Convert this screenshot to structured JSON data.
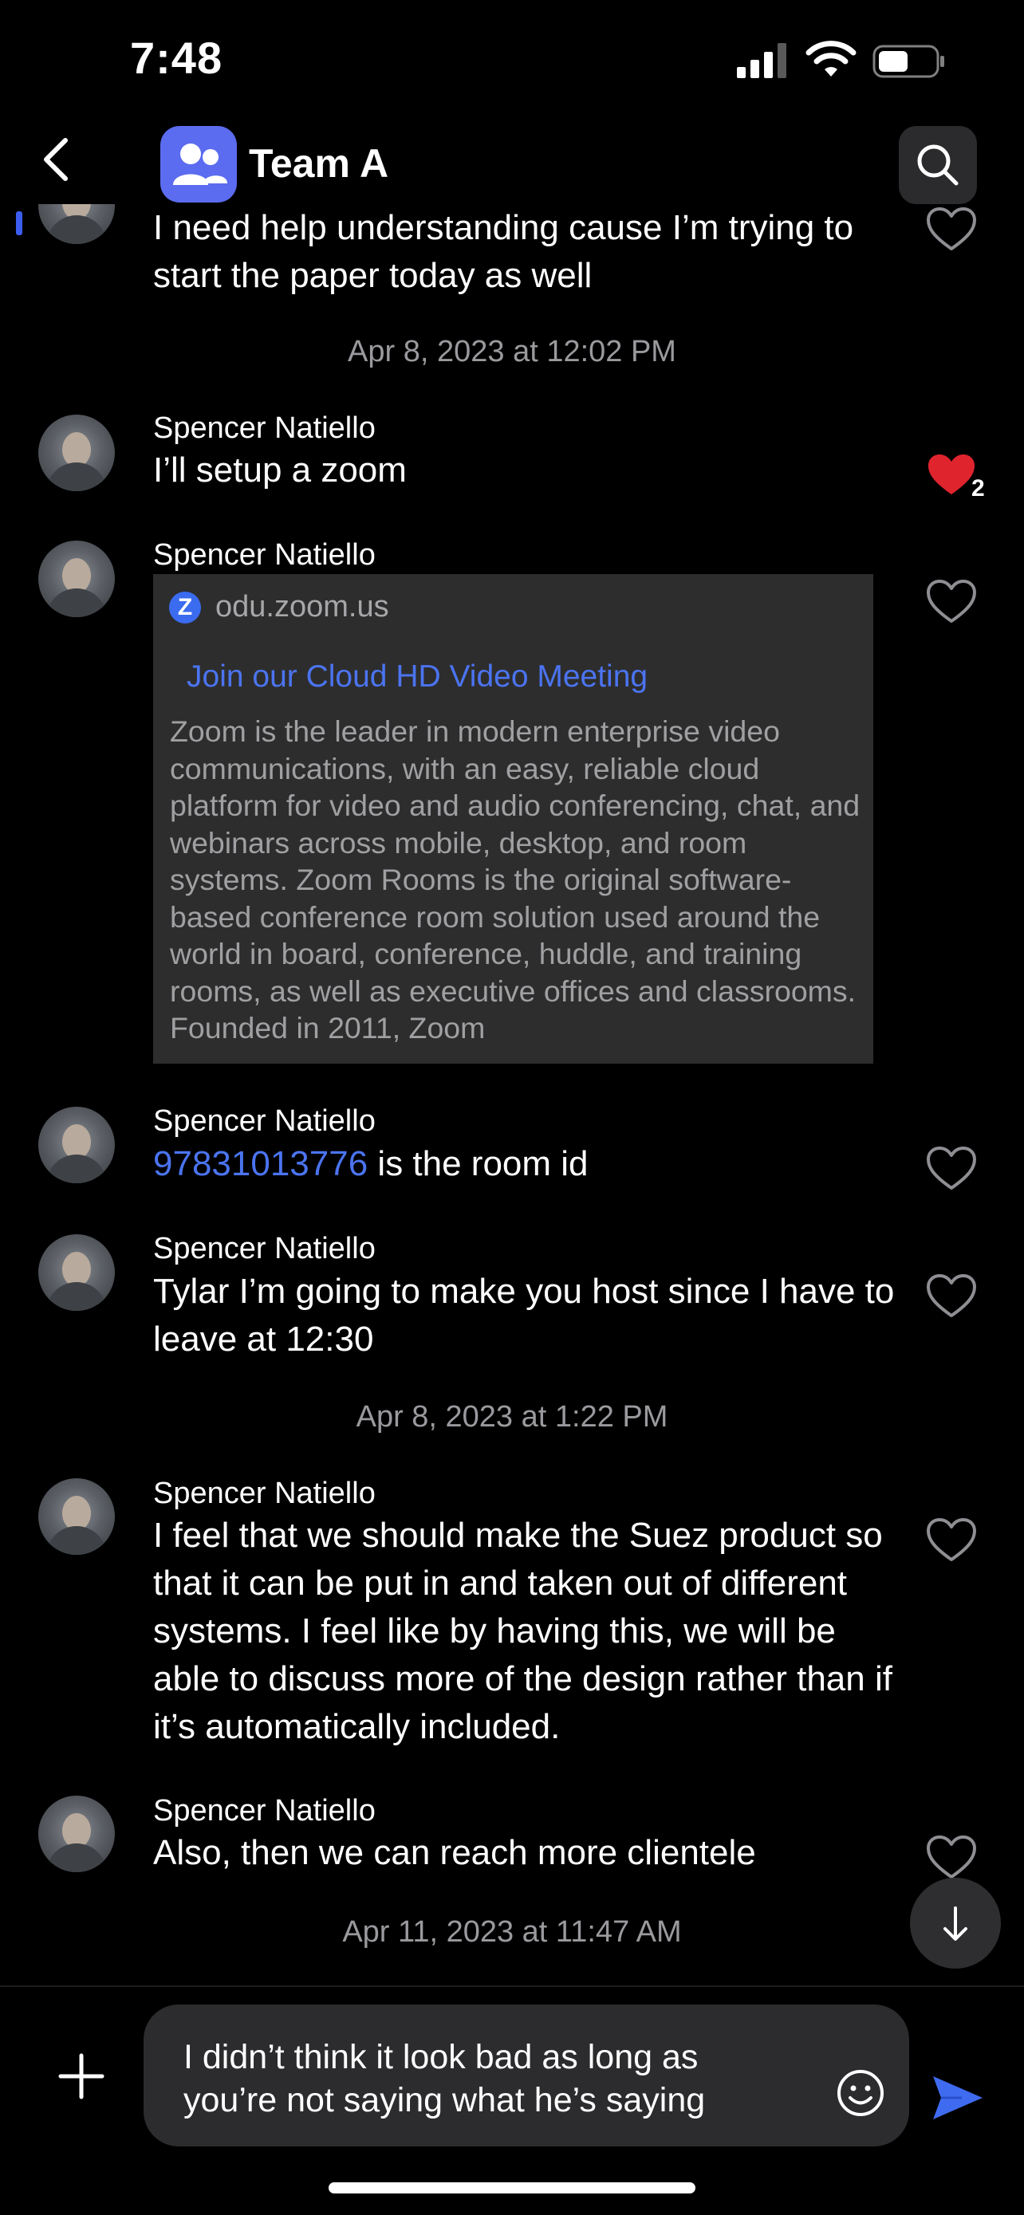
{
  "status_bar": {
    "time": "7:48"
  },
  "header": {
    "title": "Team A",
    "back_icon": "chevron-left-icon",
    "search_icon": "search-icon"
  },
  "colors": {
    "accent": "#4b74f0",
    "heart_red": "#e0242e",
    "background": "#000000",
    "card": "#2d2d2e"
  },
  "messages": [
    {
      "text": "I need help understanding cause I’m trying to start the paper today as well"
    },
    {
      "sender": "Spencer Natiello",
      "text": "I’ll setup a zoom",
      "reaction_count": "2"
    },
    {
      "sender": "Spencer Natiello"
    },
    {
      "sender": "Spencer Natiello",
      "link_text": "97831013776",
      "text": " is the room id"
    },
    {
      "sender": "Spencer Natiello",
      "text": "Tylar I’m going to make you host since I have to leave at 12:30"
    },
    {
      "sender": "Spencer Natiello",
      "text": "I feel that we should make the Suez product so that it can be put in and taken out of different systems. I feel like by having this, we will be able to discuss more of the design rather than if it’s automatically included."
    },
    {
      "sender": "Spencer Natiello",
      "text": "Also, then we can reach more clientele"
    }
  ],
  "date_separators": [
    "Apr 8, 2023 at 12:02 PM",
    "Apr 8, 2023 at 1:22 PM",
    "Apr 11, 2023 at 11:47 AM"
  ],
  "link_preview": {
    "site_letter": "Z",
    "domain": "odu.zoom.us",
    "title": "Join our Cloud HD Video Meeting",
    "description": "Zoom is the leader in modern enterprise video communications, with an easy, reliable cloud platform for video and audio conferencing, chat, and webinars across mobile, desktop, and room systems. Zoom Rooms is the original software-based conference room solution used around the world in board, conference, huddle, and training rooms, as well as executive offices and classrooms. Founded in 2011, Zoom"
  },
  "composer": {
    "text": "I didn’t think it look bad as long as you’re not saying what he’s saying"
  }
}
